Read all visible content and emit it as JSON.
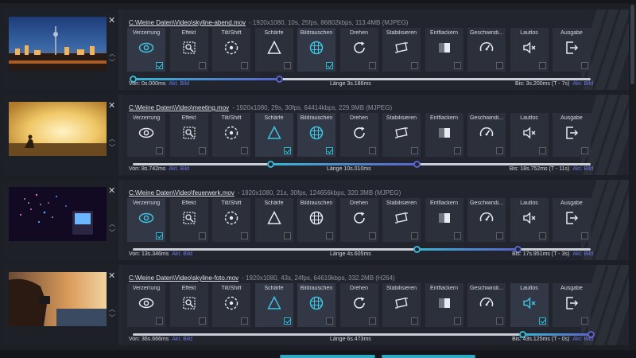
{
  "tile_labels": [
    "Verzerrung",
    "Effekt",
    "Tilt/Shift",
    "Schärfe",
    "Bildrauschen",
    "Drehen",
    "Stabilisieren",
    "Entflackern",
    "Geschwindi...",
    "Lautlos",
    "Ausgabe"
  ],
  "tile_icons": [
    "eye-icon",
    "effect-icon",
    "tilt-shift-icon",
    "sharpness-icon",
    "noise-icon",
    "rotate-icon",
    "stabilize-icon",
    "deflicker-icon",
    "speedometer-icon",
    "mute-icon",
    "export-icon"
  ],
  "colors": {
    "accent_cyan": "#3ab5d4",
    "accent_purple": "#5b63c9",
    "link": "#6f78e6"
  },
  "clips": [
    {
      "path": "C:\\Meine Daten\\Video\\skyline-abend.mov",
      "meta": "- 1920x1080, 10s, 25fps, 86802kbps, 113.4MB (MJPEG)",
      "from_label": "Von:",
      "from_value": "0s.000ms",
      "from_link": "Akt. Bild",
      "length_label": "Länge",
      "length_value": "3s.186ms",
      "to_label": "Bis:",
      "to_value": "3s.200ms (T - 7s)",
      "to_link": "Akt. Bild",
      "range": [
        0.0,
        0.32
      ],
      "checked": [
        true,
        false,
        false,
        false,
        true,
        false,
        false,
        false,
        false,
        false,
        false
      ],
      "active": [
        0,
        4
      ],
      "thumb": "city-night"
    },
    {
      "path": "C:\\Meine Daten\\Video\\meeting.mov",
      "meta": "- 1920x1080, 29s, 30fps, 64414kbps, 229.9MB (MJPEG)",
      "from_label": "Von:",
      "from_value": "8s.742ms",
      "from_link": "Akt. Bild",
      "length_label": "Länge",
      "length_value": "10s.010ms",
      "to_label": "Bis:",
      "to_value": "18s.752ms (T - 11s)",
      "to_link": "Akt. Bild",
      "range": [
        0.3,
        0.62
      ],
      "checked": [
        false,
        false,
        false,
        true,
        true,
        false,
        false,
        false,
        false,
        false,
        false
      ],
      "active": [
        3,
        4
      ],
      "thumb": "sunset-field"
    },
    {
      "path": "C:\\Meine Daten\\Video\\feuerwerk.mov",
      "meta": "- 1920x1080, 21s, 30fps, 124656kbps, 320.3MB (MJPEG)",
      "from_label": "Von:",
      "from_value": "13s.346ms",
      "from_link": "Akt. Bild",
      "length_label": "Länge",
      "length_value": "4s.605ms",
      "to_label": "Bis:",
      "to_value": "17s.951ms (T - 3s)",
      "to_link": "Akt. Bild",
      "range": [
        0.62,
        0.84
      ],
      "checked": [
        true,
        false,
        false,
        false,
        false,
        false,
        false,
        false,
        false,
        false,
        false
      ],
      "active": [
        0
      ],
      "thumb": "fireworks"
    },
    {
      "path": "C:\\Meine Daten\\Video\\skyline-foto.mov",
      "meta": "- 1920x1080, 43s, 24fps, 64619kbps, 332.2MB (H264)",
      "from_label": "Von:",
      "from_value": "36s.666ms",
      "from_link": "Akt. Bild",
      "length_label": "Länge",
      "length_value": "6s.473ms",
      "to_label": "Bis:",
      "to_value": "43s.125ms (T - 0s)",
      "to_link": "Akt. Bild",
      "range": [
        0.85,
        1.0
      ],
      "checked": [
        false,
        false,
        false,
        true,
        false,
        false,
        false,
        false,
        false,
        true,
        false
      ],
      "active": [
        3,
        4,
        9
      ],
      "thumb": "photographer"
    }
  ]
}
